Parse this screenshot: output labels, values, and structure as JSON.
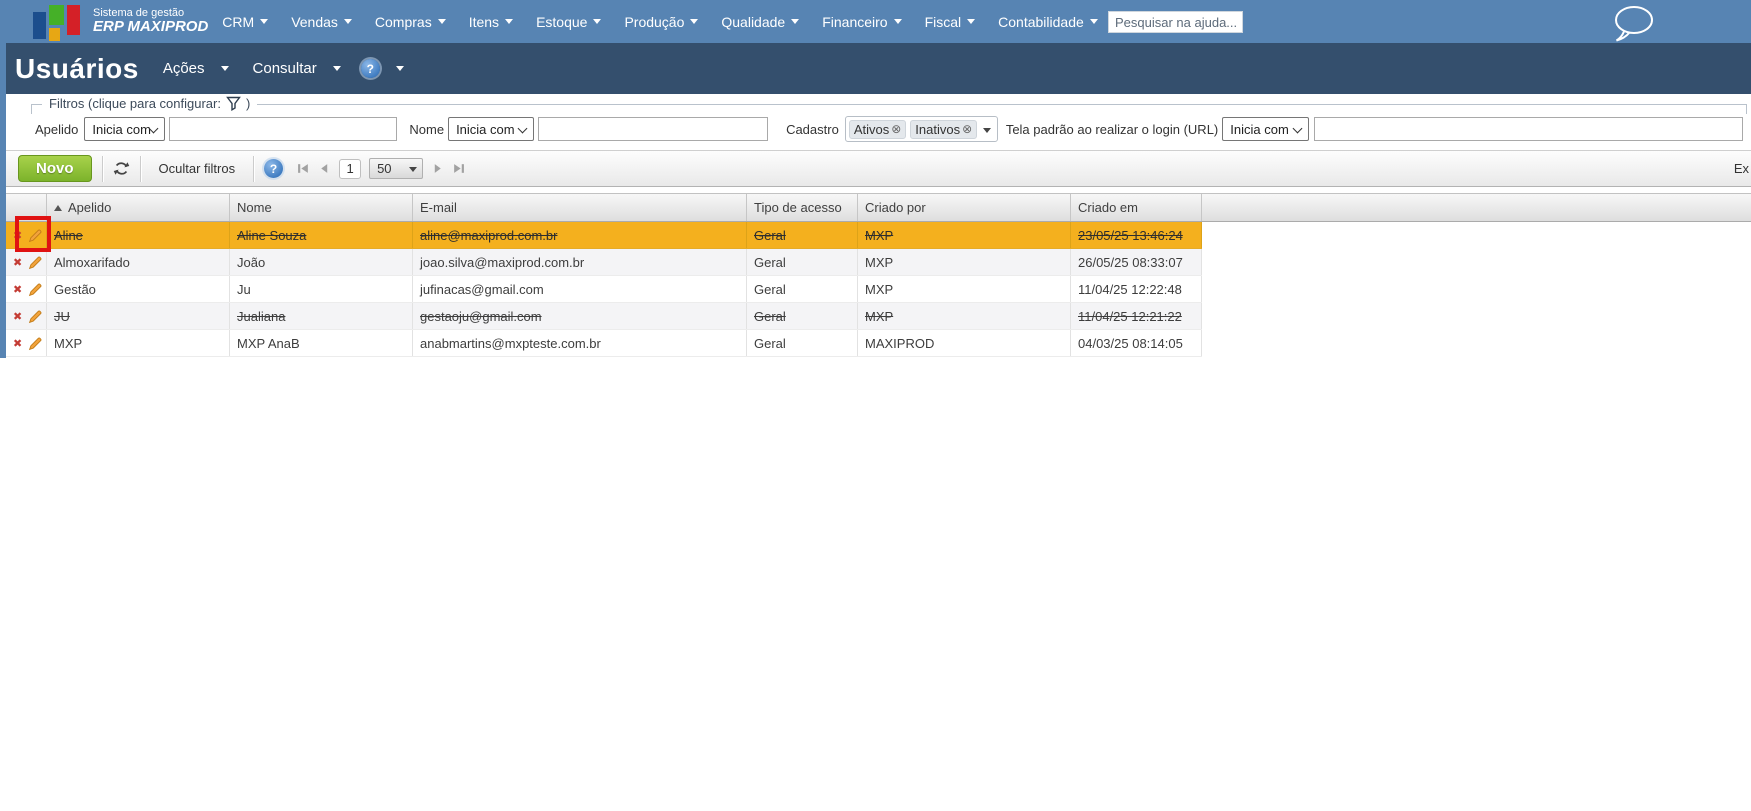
{
  "colors": {
    "topbar_blue": "#5784b3",
    "titlebar_navy": "#344f6d",
    "selected_row_orange": "#f4b01e",
    "new_button_green": "#7cb32b",
    "annotation_red": "#e01212"
  },
  "icons": {
    "help_glyph": "?",
    "delete_glyph": "✖",
    "remove_glyph": "⊗"
  },
  "topbar": {
    "logo_small": "Sistema de gestão",
    "logo_main": "ERP MAXIPROD",
    "menus": [
      "CRM",
      "Vendas",
      "Compras",
      "Itens",
      "Estoque",
      "Produção",
      "Qualidade",
      "Financeiro",
      "Fiscal",
      "Contabilidade"
    ],
    "search_placeholder": "Pesquisar na ajuda..."
  },
  "titlebar": {
    "title": "Usuários",
    "acoes_label": "Ações",
    "consultar_label": "Consultar"
  },
  "filters": {
    "legend_prefix": "Filtros (clique para configurar:",
    "legend_suffix": ")",
    "apelido": {
      "label": "Apelido",
      "operator": "Inicia com",
      "value": ""
    },
    "nome": {
      "label": "Nome",
      "operator": "Inicia com",
      "value": ""
    },
    "cadastro": {
      "label": "Cadastro",
      "tags": [
        "Ativos",
        "Inativos"
      ]
    },
    "tela_padrao": {
      "label": "Tela padrão ao realizar o login (URL)",
      "operator": "Inicia com",
      "value": ""
    }
  },
  "toolbar": {
    "new_label": "Novo",
    "hide_filters_label": "Ocultar filtros",
    "page_number": "1",
    "page_size": "50",
    "export_label_partial": "Ex"
  },
  "table": {
    "columns": [
      "Apelido",
      "Nome",
      "E-mail",
      "Tipo de acesso",
      "Criado por",
      "Criado em"
    ],
    "rows": [
      {
        "apelido": "Aline",
        "nome": "Aline Souza",
        "email": "aline@maxiprod.com.br",
        "tipo": "Geral",
        "criado_por": "MXP",
        "criado_em": "23/05/25 13:46:24",
        "selected": true,
        "inactive": true
      },
      {
        "apelido": "Almoxarifado",
        "nome": "João",
        "email": "joao.silva@maxiprod.com.br",
        "tipo": "Geral",
        "criado_por": "MXP",
        "criado_em": "26/05/25 08:33:07",
        "selected": false,
        "inactive": false
      },
      {
        "apelido": "Gestão",
        "nome": "Ju",
        "email": "jufinacas@gmail.com",
        "tipo": "Geral",
        "criado_por": "MXP",
        "criado_em": "11/04/25 12:22:48",
        "selected": false,
        "inactive": false
      },
      {
        "apelido": "JU",
        "nome": "Jualiana",
        "email": "gestaoju@gmail.com",
        "tipo": "Geral",
        "criado_por": "MXP",
        "criado_em": "11/04/25 12:21:22",
        "selected": false,
        "inactive": true
      },
      {
        "apelido": "MXP",
        "nome": "MXP AnaB",
        "email": "anabmartins@mxpteste.com.br",
        "tipo": "Geral",
        "criado_por": "MAXIPROD",
        "criado_em": "04/03/25 08:14:05",
        "selected": false,
        "inactive": false
      }
    ]
  }
}
